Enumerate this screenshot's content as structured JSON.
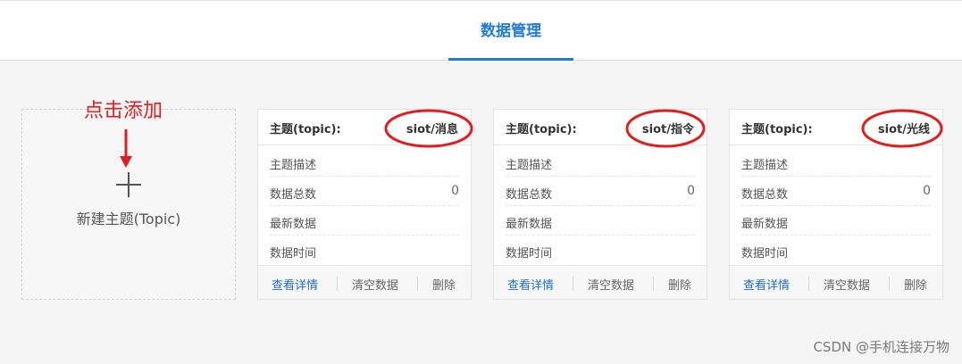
{
  "header": {
    "tab_label": "数据管理"
  },
  "add_card": {
    "label": "新建主题(Topic)",
    "plus_icon": "plus-icon"
  },
  "annotation": {
    "text": "点击添加",
    "color": "#e01e1e"
  },
  "cards": [
    {
      "title": "主题(topic):",
      "topic": "siot/消息",
      "rows": [
        {
          "label": "主题描述",
          "value": ""
        },
        {
          "label": "数据总数",
          "value": "0"
        },
        {
          "label": "最新数据",
          "value": ""
        },
        {
          "label": "数据时间",
          "value": ""
        }
      ],
      "actions": {
        "detail": "查看详情",
        "clear": "清空数据",
        "delete": "删除"
      }
    },
    {
      "title": "主题(topic):",
      "topic": "siot/指令",
      "rows": [
        {
          "label": "主题描述",
          "value": ""
        },
        {
          "label": "数据总数",
          "value": "0"
        },
        {
          "label": "最新数据",
          "value": ""
        },
        {
          "label": "数据时间",
          "value": ""
        }
      ],
      "actions": {
        "detail": "查看详情",
        "clear": "清空数据",
        "delete": "删除"
      }
    },
    {
      "title": "主题(topic):",
      "topic": "siot/光线",
      "rows": [
        {
          "label": "主题描述",
          "value": ""
        },
        {
          "label": "数据总数",
          "value": "0"
        },
        {
          "label": "最新数据",
          "value": ""
        },
        {
          "label": "数据时间",
          "value": ""
        }
      ],
      "actions": {
        "detail": "查看详情",
        "clear": "清空数据",
        "delete": "删除"
      }
    }
  ],
  "watermark": "CSDN @手机连接万物",
  "colors": {
    "accent": "#1f7ad8",
    "link": "#1f6fc4",
    "annotation": "#e01e1e"
  }
}
